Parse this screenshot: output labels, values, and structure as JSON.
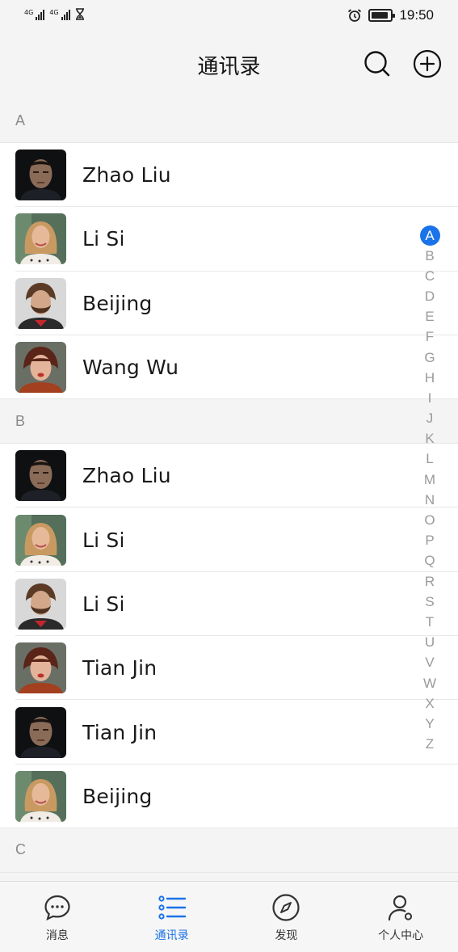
{
  "status_bar": {
    "sim1_tag": "4G",
    "sim2_tag": "4G",
    "time": "19:50",
    "icons": [
      "signal-icon",
      "signal-icon",
      "hourglass-icon",
      "alarm-icon",
      "battery-icon"
    ]
  },
  "header": {
    "title": "通讯录",
    "icons": [
      "search-icon",
      "add-icon"
    ]
  },
  "sections": [
    {
      "letter": "A",
      "contacts": [
        {
          "name": "Zhao Liu",
          "avatar": "man-dark"
        },
        {
          "name": "Li Si",
          "avatar": "woman-blonde"
        },
        {
          "name": "Beijing",
          "avatar": "man-beard"
        },
        {
          "name": "Wang Wu",
          "avatar": "woman-red"
        }
      ]
    },
    {
      "letter": "B",
      "contacts": [
        {
          "name": "Zhao Liu",
          "avatar": "man-dark"
        },
        {
          "name": "Li Si",
          "avatar": "woman-blonde"
        },
        {
          "name": "Li Si",
          "avatar": "man-beard"
        },
        {
          "name": "Tian Jin",
          "avatar": "woman-red"
        },
        {
          "name": "Tian Jin",
          "avatar": "man-dark"
        },
        {
          "name": "Beijing",
          "avatar": "woman-blonde"
        }
      ]
    },
    {
      "letter": "C",
      "contacts": []
    }
  ],
  "alpha_index": {
    "letters": [
      "A",
      "B",
      "C",
      "D",
      "E",
      "F",
      "G",
      "H",
      "I",
      "J",
      "K",
      "L",
      "M",
      "N",
      "O",
      "P",
      "Q",
      "R",
      "S",
      "T",
      "U",
      "V",
      "W",
      "X",
      "Y",
      "Z"
    ],
    "active": "A",
    "active_color": "#1a73e8"
  },
  "tab_bar": {
    "active_color": "#1a73e8",
    "tabs": [
      {
        "label": "消息",
        "icon": "chat-bubble-icon",
        "active": false
      },
      {
        "label": "通讯录",
        "icon": "contacts-list-icon",
        "active": true
      },
      {
        "label": "发现",
        "icon": "compass-icon",
        "active": false
      },
      {
        "label": "个人中心",
        "icon": "user-profile-icon",
        "active": false
      }
    ]
  }
}
